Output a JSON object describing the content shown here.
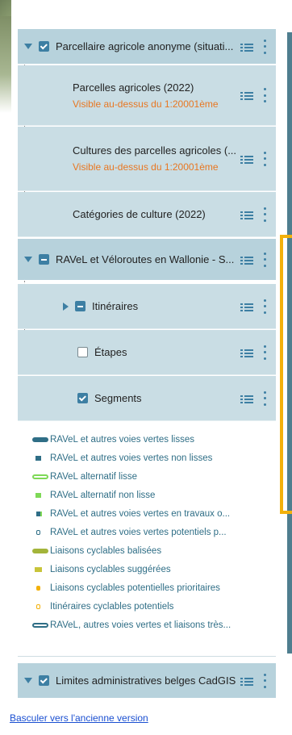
{
  "layers": {
    "group1": {
      "label": "Parcellaire agricole anonyme (situati...",
      "children": [
        {
          "label": "Parcelles agricoles (2022)",
          "note": "Visible au-dessus du 1:20001ème"
        },
        {
          "label": "Cultures des parcelles agricoles (...",
          "note": "Visible au-dessus du 1:20001ème"
        },
        {
          "label": "Catégories de culture (2022)"
        }
      ]
    },
    "group2": {
      "label": "RAVeL et Véloroutes en Wallonie - S...",
      "children": [
        {
          "label": "Itinéraires"
        },
        {
          "label": "Étapes"
        },
        {
          "label": "Segments"
        }
      ]
    },
    "group3": {
      "label": "Limites administratives belges CadGIS"
    }
  },
  "legend": [
    "RAVeL et autres voies vertes lisses",
    "RAVeL et autres voies vertes non lisses",
    "RAVeL alternatif lisse",
    "RAVeL alternatif non lisse",
    "RAVeL et autres voies vertes en travaux o...",
    "RAVeL et autres voies vertes potentiels p...",
    "Liaisons cyclables balisées",
    "Liaisons cyclables suggérées",
    "Liaisons cyclables potentielles prioritaires",
    "Itinéraires cyclables potentiels",
    "RAVeL, autres voies vertes et liaisons très..."
  ],
  "footer": {
    "link": "Basculer vers l'ancienne version"
  },
  "colors": {
    "accent": "#3d7fa3",
    "group_bg": "#b7d2dc",
    "note": "#e87722",
    "highlight": "#f3b10b"
  }
}
